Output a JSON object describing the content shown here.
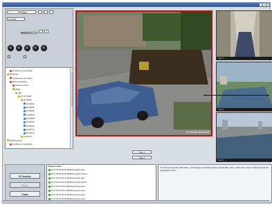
{
  "window": {
    "title": "",
    "subtitle": ""
  },
  "top_controls": {
    "field_1": "",
    "field_2": "2005",
    "field_3": "10:58:05"
  },
  "tree": {
    "items": [
      {
        "label": "Continuous recording",
        "level": 1,
        "icon": "record"
      },
      {
        "label": "Brickway",
        "level": 0,
        "icon": "folder"
      },
      {
        "label": "Continuous recording",
        "level": 1,
        "icon": "record"
      },
      {
        "label": "Event recording",
        "level": 1,
        "icon": "record"
      },
      {
        "label": "Camera event",
        "level": 2,
        "icon": "record"
      },
      {
        "label": "2005",
        "level": 2,
        "icon": "folder"
      },
      {
        "label": "July",
        "level": 3,
        "icon": "folder"
      },
      {
        "label": "27.07.2005",
        "level": 4,
        "icon": "folder"
      },
      {
        "label": "10:00:00",
        "level": 5,
        "icon": "folder"
      },
      {
        "label": "10:58:04",
        "level": 6,
        "icon": "cam"
      },
      {
        "label": "10:58:05",
        "level": 6,
        "icon": "cam"
      },
      {
        "label": "10:58:06",
        "level": 6,
        "icon": "cam"
      },
      {
        "label": "10:58:07",
        "level": 6,
        "icon": "cam"
      },
      {
        "label": "10:58:08",
        "level": 6,
        "icon": "cam"
      },
      {
        "label": "10:58:09",
        "level": 6,
        "icon": "cam"
      },
      {
        "label": "10:58:10",
        "level": 6,
        "icon": "cam"
      },
      {
        "label": "10:58:11",
        "level": 6,
        "icon": "cam"
      },
      {
        "label": "10:58:12",
        "level": 6,
        "icon": "cam"
      },
      {
        "label": "11:00:00",
        "level": 5,
        "icon": "folder"
      },
      {
        "label": "Building front",
        "level": 0,
        "icon": "folder"
      },
      {
        "label": "Continuous recording",
        "level": 1,
        "icon": "record"
      }
    ]
  },
  "main_video": {
    "timestamp": "27.07.05  10:21:03"
  },
  "side_videos": [
    {
      "caption": "Cam 1 ..."
    },
    {
      "caption": "Cam 2 ..."
    },
    {
      "caption": "Cam 3 ..."
    }
  ],
  "bottom_left": {
    "archive_label": "PC Archive",
    "setup_label": "Setup",
    "close_label": "Close"
  },
  "log": {
    "header": "Device events",
    "rows": [
      "26.07.05 09:44:23 [0002] Program start",
      "26.07.05 09:44:50 [0002] Program started",
      "26.07.05 10:12:44 [0002] Program start",
      "26.07.05 10:13:01 [0002] Program started",
      "27.07.05 10:21:03 [0003] Camera event",
      "27.07.05 10:22:14 [0003] Camera event",
      "27.07.05 10:25:40 [0003] Camera event",
      "27.07.05 10:30:00 [0003] Camera event"
    ]
  },
  "playback": {
    "play_label": "Play 1",
    "play2_label": "Play 2"
  },
  "info_panel": {
    "text": "To select the specific information, such as logs and detail, please use the filter option. Select the relevant data and click the appropriate button."
  }
}
